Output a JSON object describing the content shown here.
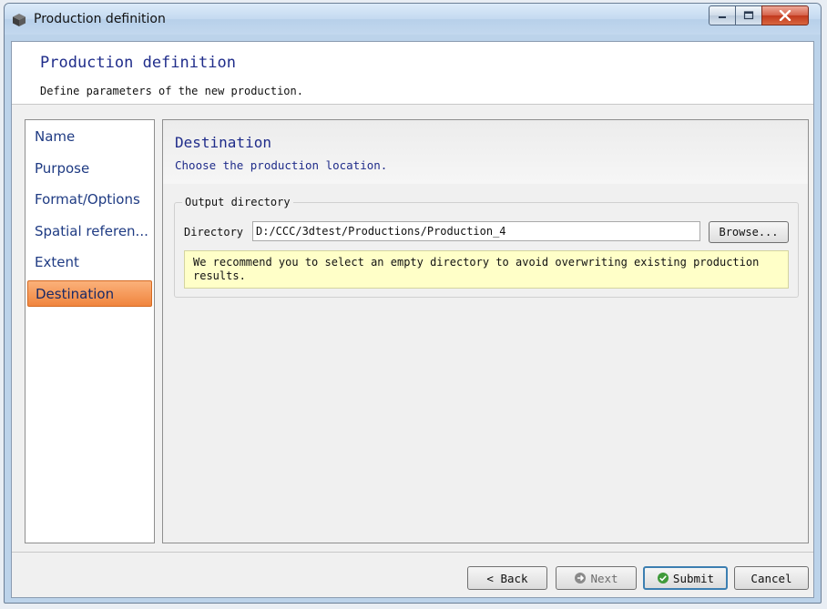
{
  "window": {
    "title": "Production definition",
    "icon": "cube-icon",
    "controls": {
      "minimize": "minimize-icon",
      "maximize": "maximize-icon",
      "close": "close-icon"
    }
  },
  "header": {
    "title": "Production definition",
    "description": "Define parameters of the new production."
  },
  "sidebar": {
    "items": [
      {
        "label": "Name",
        "active": false
      },
      {
        "label": "Purpose",
        "active": false
      },
      {
        "label": "Format/Options",
        "active": false
      },
      {
        "label": "Spatial referen...",
        "active": false
      },
      {
        "label": "Extent",
        "active": false
      },
      {
        "label": "Destination",
        "active": true
      }
    ]
  },
  "page": {
    "title": "Destination",
    "description": "Choose the production location.",
    "group": {
      "legend": "Output directory",
      "directory_label": "Directory",
      "directory_value": "D:/CCC/3dtest/Productions/Production_4",
      "browse_label": "Browse...",
      "warning": "We recommend you to select an empty directory to avoid overwriting existing production results."
    }
  },
  "footer": {
    "back_label": "< Back",
    "next_label": "Next",
    "submit_label": "Submit",
    "cancel_label": "Cancel"
  },
  "colors": {
    "accent": "#f0853e",
    "title_blue": "#1f2c8a",
    "warning_bg": "#ffffc8"
  }
}
